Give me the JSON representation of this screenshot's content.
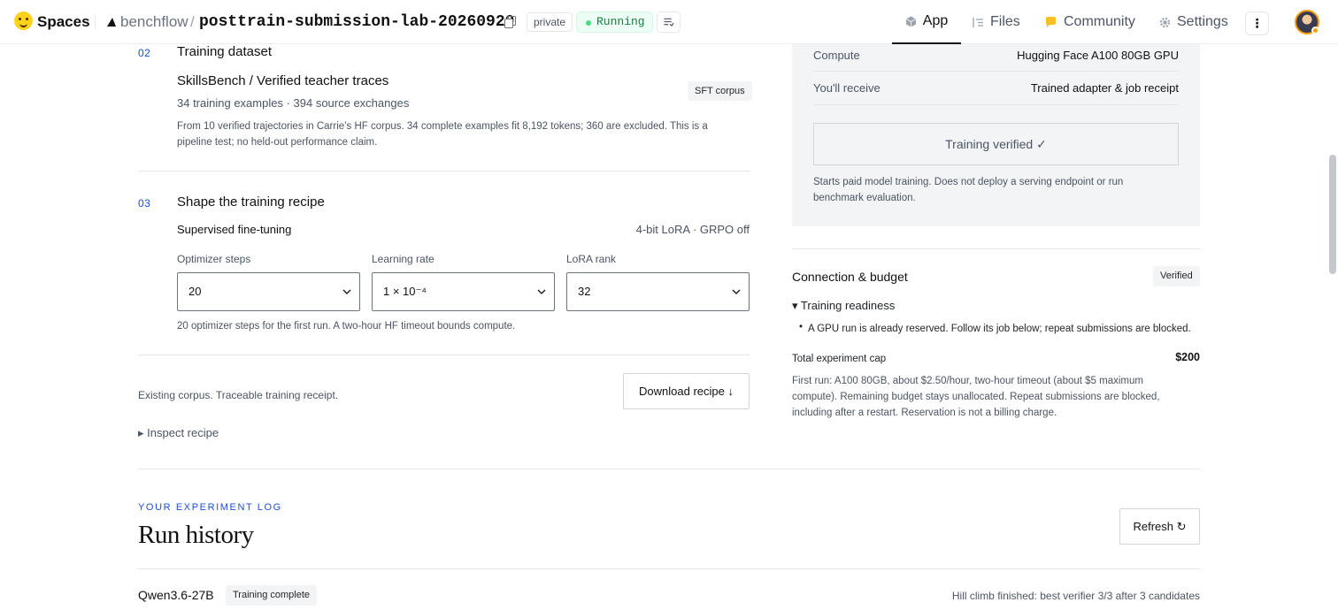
{
  "topbar": {
    "spaces_label": "Spaces",
    "owner": "benchflow",
    "separator": "/",
    "repo": "posttrain-submission-lab-20260920",
    "visibility": "private",
    "status": "Running",
    "nav": {
      "app": "App",
      "files": "Files",
      "community": "Community",
      "settings": "Settings"
    },
    "more": "⋮"
  },
  "section_dataset": {
    "number": "02",
    "title": "Training dataset",
    "dataset_name": "SkillsBench / Verified teacher traces",
    "counts": "34 training examples · 394 source exchanges",
    "tag": "SFT corpus",
    "note": "From 10 verified trajectories in Carrie’s HF corpus. 34 complete examples fit 8,192 tokens; 360 are excluded. This is a pipeline test; no held-out performance claim."
  },
  "section_recipe": {
    "number": "03",
    "title": "Shape the training recipe",
    "method": "Supervised fine-tuning",
    "method_meta": "4-bit LoRA · GRPO off",
    "fields": {
      "steps_label": "Optimizer steps",
      "steps_value": "20",
      "lr_label": "Learning rate",
      "lr_value": "1 × 10⁻⁴",
      "rank_label": "LoRA rank",
      "rank_value": "32"
    },
    "hint": "20 optimizer steps for the first run. A two-hour HF timeout bounds compute."
  },
  "recipe_footer": {
    "note": "Existing corpus. Traceable training receipt.",
    "download_label": "Download recipe ↓",
    "inspect_label": "▸ Inspect recipe"
  },
  "summary": {
    "compute_label": "Compute",
    "compute_value": "Hugging Face A100 80GB GPU",
    "receive_label": "You'll receive",
    "receive_value": "Trained adapter & job receipt",
    "verified_label": "Training verified ✓",
    "disclaimer": "Starts paid model training. Does not deploy a serving endpoint or run benchmark evaluation."
  },
  "connection": {
    "title": "Connection & budget",
    "badge": "Verified",
    "readiness_label": "▾ Training readiness",
    "readiness_item": "A GPU run is already reserved. Follow its job below; repeat submissions are blocked.",
    "cap_label": "Total experiment cap",
    "cap_value": "$200",
    "cap_note": "First run: A100 80GB, about $2.50/hour, two-hour timeout (about $5 maximum compute). Remaining budget stays unallocated. Repeat submissions are blocked, including after a restart. Reservation is not a billing charge."
  },
  "history": {
    "eyebrow": "YOUR EXPERIMENT LOG",
    "title": "Run history",
    "refresh_label": "Refresh ↻",
    "rows": [
      {
        "model": "Qwen3.6-27B",
        "status": "Training complete",
        "summary": "Hill climb finished: best verifier 3/3 after 3 candidates"
      }
    ]
  }
}
